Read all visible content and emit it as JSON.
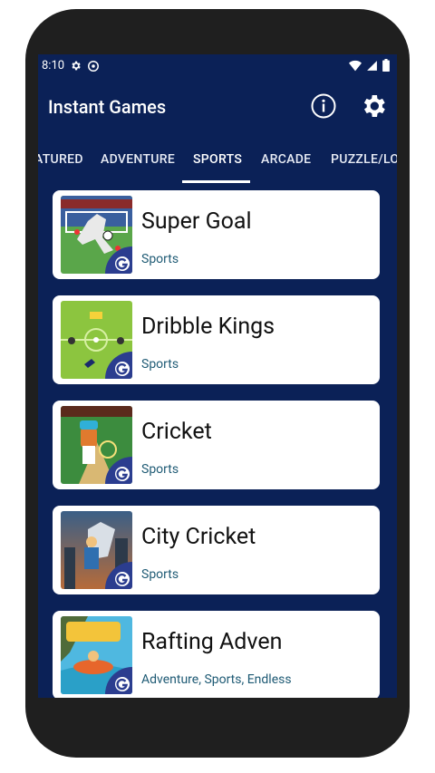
{
  "status": {
    "time": "8:10"
  },
  "app": {
    "title": "Instant Games"
  },
  "tabs": [
    {
      "label": "ATURED"
    },
    {
      "label": "ADVENTURE"
    },
    {
      "label": "SPORTS",
      "active": true
    },
    {
      "label": "ARCADE"
    },
    {
      "label": "PUZZLE/LO"
    }
  ],
  "games": [
    {
      "title": "Super Goal",
      "category": "Sports"
    },
    {
      "title": "Dribble Kings",
      "category": "Sports"
    },
    {
      "title": "Cricket",
      "category": "Sports"
    },
    {
      "title": "City Cricket",
      "category": "Sports"
    },
    {
      "title": "Rafting Adven",
      "category": "Adventure, Sports, Endless"
    }
  ],
  "colors": {
    "background": "#0b2157",
    "accent": "#1e5a74",
    "card": "#ffffff",
    "badge": "#2b3d8f"
  },
  "icons": {
    "info": "info-icon",
    "settings": "gear-icon"
  }
}
